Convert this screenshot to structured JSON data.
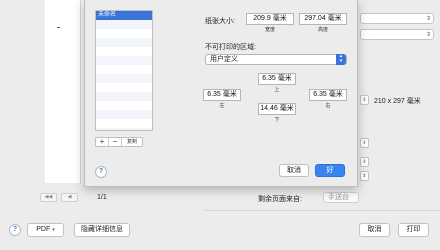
{
  "print_dialog": {
    "paper_size_value": "210 x 297 毫米",
    "page_counter": "1/1",
    "remaining_pages_label": "剩余页面来自:",
    "remaining_pages_value": "手送台",
    "pdf_label": "PDF",
    "hide_details_label": "隐藏详细信息",
    "cancel_label": "取消",
    "print_label": "打印",
    "help_label": "?"
  },
  "page_setup_sheet": {
    "size_list": {
      "items": [
        "未命名"
      ],
      "selected_index": 0
    },
    "list_controls": {
      "add_label": "+",
      "remove_label": "−",
      "duplicate_label": "复制"
    },
    "paper_size": {
      "label": "纸张大小:",
      "width": "209.9 毫米",
      "height": "297.04 毫米",
      "width_caption": "宽度",
      "height_caption": "高度"
    },
    "non_printable_area": {
      "label": "不可打印的区域:",
      "selected_option": "用户定义",
      "top": "6.35 毫米",
      "top_caption": "上",
      "left": "6.35 毫米",
      "left_caption": "左",
      "right": "6.35 毫米",
      "right_caption": "右",
      "bottom": "14.46 毫米",
      "bottom_caption": "下"
    },
    "help_label": "?",
    "cancel_label": "取消",
    "ok_label": "好"
  },
  "colors": {
    "accent": "#3a84f0",
    "selection": "#3a73d8",
    "window_bg": "#ececec"
  }
}
